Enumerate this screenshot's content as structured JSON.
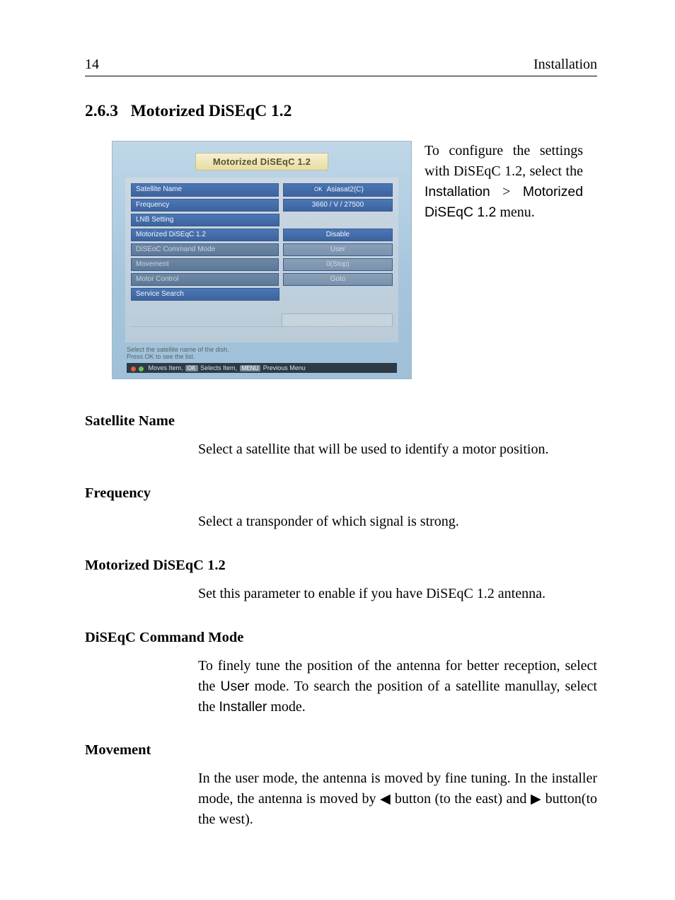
{
  "header": {
    "page_number": "14",
    "chapter_title": "Installation"
  },
  "section": {
    "number": "2.6.3",
    "title": "Motorized DiSEqC 1.2"
  },
  "screenshot": {
    "dialog_title": "Motorized DiSEqC 1.2",
    "rows": [
      {
        "label": "Satellite Name",
        "value_prefix": "OK",
        "value": "Asiasat2(C)",
        "disabled": false,
        "has_value": true
      },
      {
        "label": "Frequency",
        "value": "3660 / V / 27500",
        "disabled": false,
        "has_value": true
      },
      {
        "label": "LNB Setting",
        "value": "",
        "disabled": false,
        "has_value": false
      },
      {
        "label": "Motorized DiSEqC 1.2",
        "value": "Disable",
        "disabled": false,
        "has_value": true
      },
      {
        "label": "DiSEoC Command Mode",
        "value": "User",
        "disabled": true,
        "has_value": true
      },
      {
        "label": "Movement",
        "value": "0(Stop)",
        "disabled": true,
        "has_value": true
      },
      {
        "label": "Motor Control",
        "value": "Goto",
        "disabled": true,
        "has_value": true
      },
      {
        "label": "Service Search",
        "value": "",
        "disabled": false,
        "has_value": false
      }
    ],
    "hint_line1": "Select the satellite name of the dish.",
    "hint_line2": "Press OK to see the list.",
    "hint_bar_moves": "Moves Item,",
    "hint_bar_ok": "OK",
    "hint_bar_selects": "Selects Item,",
    "hint_bar_menu": "MENU",
    "hint_bar_prev": "Previous Menu"
  },
  "intro": {
    "part1": "To configure the settings with DiSEqC 1.2, select the ",
    "menu_path_1": "Installation",
    "gt": ">",
    "menu_path_2": "Motorized DiSEqC 1.2",
    "part2": " menu."
  },
  "defs": {
    "sat_name": {
      "term": "Satellite Name",
      "desc": "Select a satellite that will be used to identify a motor position."
    },
    "frequency": {
      "term": "Frequency",
      "desc": "Select a transponder of which signal is strong."
    },
    "motorized": {
      "term": "Motorized DiSEqC 1.2",
      "desc": "Set this parameter to enable if you have DiSEqC 1.2 antenna."
    },
    "cmd_mode": {
      "term": "DiSEqC Command Mode",
      "pre": "To finely tune the position of the antenna for better reception, select the ",
      "user": "User",
      "mid": " mode. To search the position of a satellite man­ullay, select the ",
      "installer": "Installer",
      "post": " mode."
    },
    "movement": {
      "term": "Movement",
      "pre": "In the user mode, the antenna is moved by fine tuning. In the installer mode, the antenna is moved by ",
      "left": "◀",
      "mid1": " button (to the east) and ",
      "right": "▶",
      "post": " button(to the west)."
    }
  }
}
